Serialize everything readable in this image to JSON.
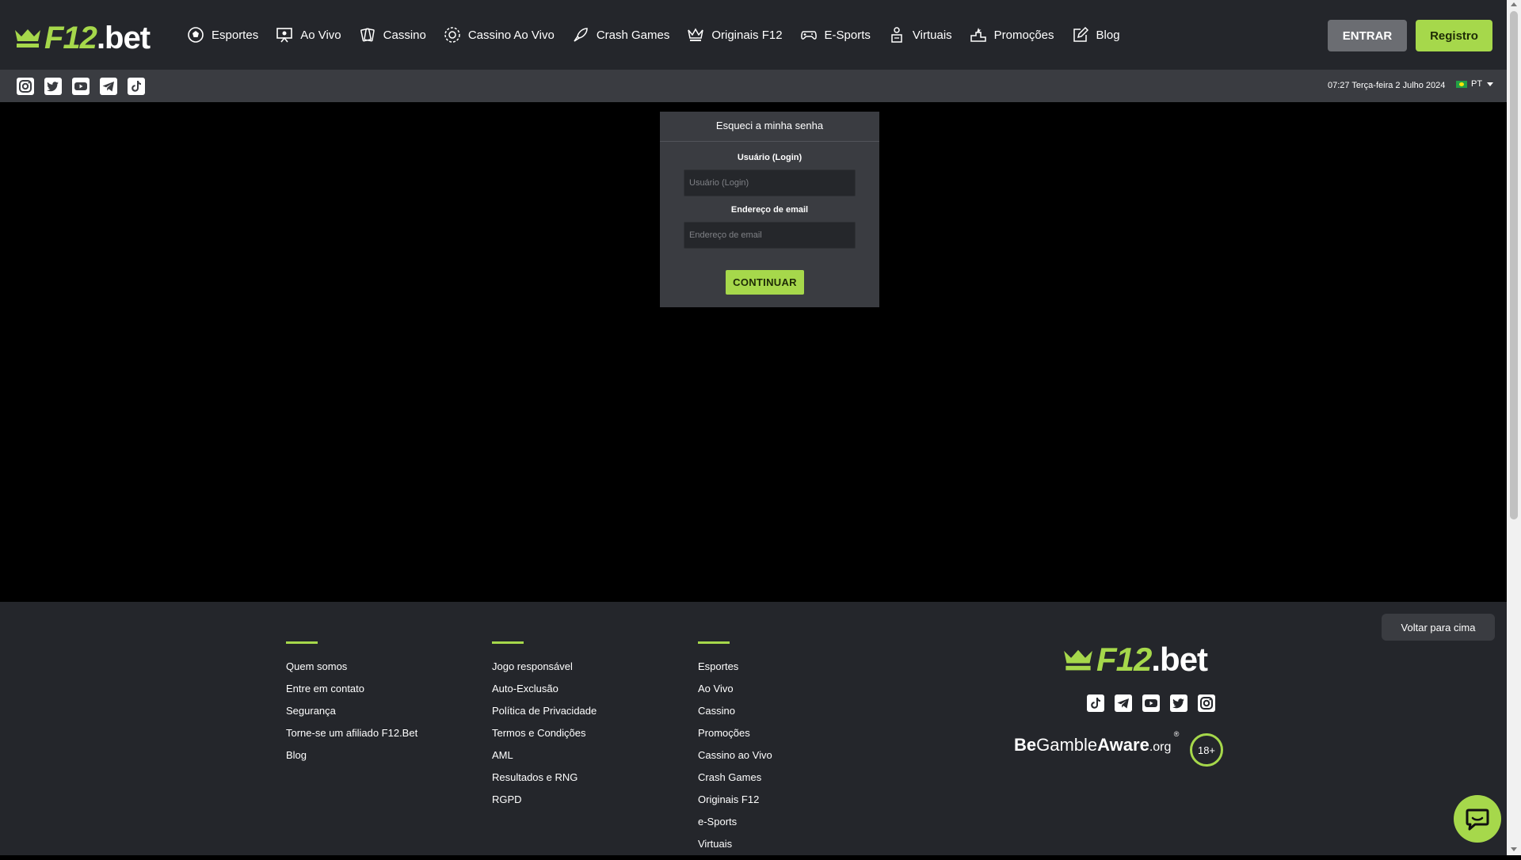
{
  "header": {
    "logo": {
      "f12": "F12",
      "bet": ".bet"
    },
    "nav": [
      {
        "label": "Esportes",
        "icon": "soccer-ball-icon"
      },
      {
        "label": "Ao Vivo",
        "icon": "live-tv-icon"
      },
      {
        "label": "Cassino",
        "icon": "cards-icon"
      },
      {
        "label": "Cassino Ao Vivo",
        "icon": "roulette-icon"
      },
      {
        "label": "Crash Games",
        "icon": "rocket-icon"
      },
      {
        "label": "Originais F12",
        "icon": "crown-icon"
      },
      {
        "label": "E-Sports",
        "icon": "gamepad-icon"
      },
      {
        "label": "Virtuais",
        "icon": "virtual-player-icon"
      },
      {
        "label": "Promoções",
        "icon": "podium-icon"
      },
      {
        "label": "Blog",
        "icon": "edit-icon"
      }
    ],
    "entrar_label": "ENTRAR",
    "registro_label": "Registro"
  },
  "subbar": {
    "social": [
      "instagram-icon",
      "twitter-icon",
      "youtube-icon",
      "telegram-icon",
      "tiktok-icon"
    ],
    "datetime": "07:27 Terça-feira 2 Julho 2024",
    "language": "PT"
  },
  "forgot": {
    "title": "Esqueci a minha senha",
    "username_label": "Usuário (Login)",
    "username_placeholder": "Usuário (Login)",
    "username_value": "",
    "email_label": "Endereço de email",
    "email_placeholder": "Endereço de email",
    "email_value": "",
    "continue_label": "CONTINUAR"
  },
  "footer": {
    "col1": [
      "Quem somos",
      "Entre em contato",
      "Segurança",
      "Torne-se um afiliado F12.Bet",
      "Blog"
    ],
    "col2": [
      "Jogo responsável",
      "Auto-Exclusão",
      "Política de Privacidade",
      "Termos e Condições",
      "AML",
      "Resultados e RNG",
      "RGPD"
    ],
    "col3": [
      "Esportes",
      "Ao Vivo",
      "Cassino",
      "Promoções",
      "Cassino ao Vivo",
      "Crash Games",
      "Originais F12",
      "e-Sports",
      "Virtuais"
    ],
    "logo": {
      "f12": "F12",
      "bet": ".bet"
    },
    "social": [
      "tiktok-icon",
      "telegram-icon",
      "youtube-icon",
      "twitter-icon",
      "instagram-icon"
    ],
    "begamble": {
      "be": "Be",
      "gamble": "Gamble",
      "aware": "Aware",
      "org": ".org",
      "reg": "®"
    },
    "age": "18+",
    "back_to_top": "Voltar para cima"
  },
  "colors": {
    "accent": "#a6d84b",
    "header_bg": "#24262b",
    "panel_bg": "#3a3c41",
    "page_bg": "#000000"
  }
}
